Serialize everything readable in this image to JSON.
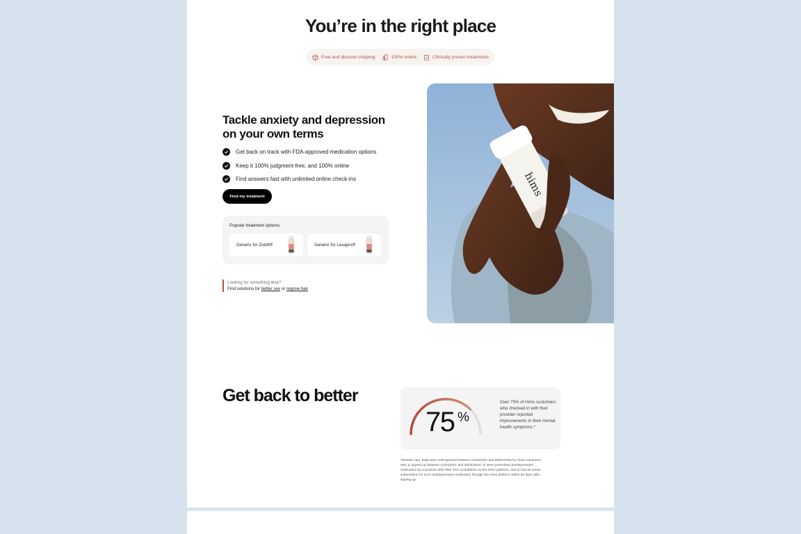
{
  "hero": {
    "title": "You’re in the right place"
  },
  "badges": [
    {
      "label": "Free and discreet shipping",
      "icon": "box-icon"
    },
    {
      "label": "100% online",
      "icon": "devices-icon"
    },
    {
      "label": "Clinically proven treatments",
      "icon": "clipboard-check-icon"
    }
  ],
  "intro": {
    "heading": "Tackle anxiety and depression on your own terms",
    "bullets": [
      "Get back on track with FDA-approved medication options",
      "Keep it 100% judgment-free, and 100% online",
      "Find answers fast with unlimited online check-ins"
    ],
    "cta_label": "Find my treatment"
  },
  "popular": {
    "label": "Popular treatment options",
    "items": [
      {
        "label": "Generic for Zoloft®"
      },
      {
        "label": "Generic for Lexapro®"
      }
    ]
  },
  "looking": {
    "line1": "Looking for something else?",
    "prefix": "Find solutions for",
    "link1": "better sex",
    "connector": "or",
    "link2": "regrow hair"
  },
  "photo": {
    "bottle_text": "hims"
  },
  "stats": {
    "heading": "Get back to better",
    "number": "75",
    "unit": "%",
    "percent_value": 75,
    "description": "Over 75% of Hims customers who checked in with their provider reported improvements in their mental health symptoms.*",
    "footnote": "*Results vary. Data were self-reported between 11/30/2021 and 06/01/2022 by Hims customers who 1) signed up between 11/04/2021 and 05/04/2022; 2) were prescribed antidepressant medication by a provider after their first consultation on the Hims platform; and 3) had an active subscription for such antidepressant medication through the Hims platform within 60 days after signing up."
  },
  "colors": {
    "accent": "#b2543e",
    "page_bg": "#d6e3ee",
    "card_bg": "#f4f4f4",
    "button": "#000000"
  }
}
